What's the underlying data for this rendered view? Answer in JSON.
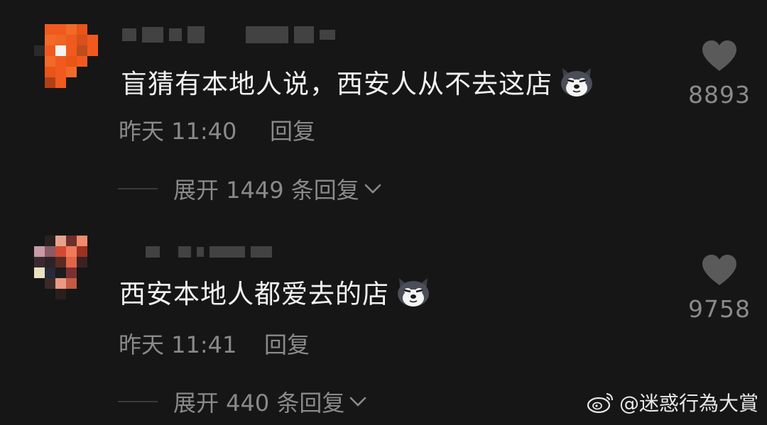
{
  "comments": [
    {
      "text": "盲猜有本地人说，西安人从不去这店",
      "emoji": "husky-emoji",
      "time": "昨天 11:40",
      "reply_label": "回复",
      "expand_label": "展开 1449 条回复",
      "likes": "8893"
    },
    {
      "text": "西安本地人都爱去的店",
      "emoji": "husky-emoji",
      "time": "昨天 11:41",
      "reply_label": "回复",
      "expand_label": "展开 440 条回复",
      "likes": "9758"
    }
  ],
  "watermark": {
    "text": "@迷惑行為大賞",
    "icon": "weibo-icon"
  },
  "colors": {
    "background": "#161616",
    "text_primary": "#f2f2f2",
    "text_secondary": "#8a8a8a",
    "avatar1_accent": "#f05a1e"
  }
}
